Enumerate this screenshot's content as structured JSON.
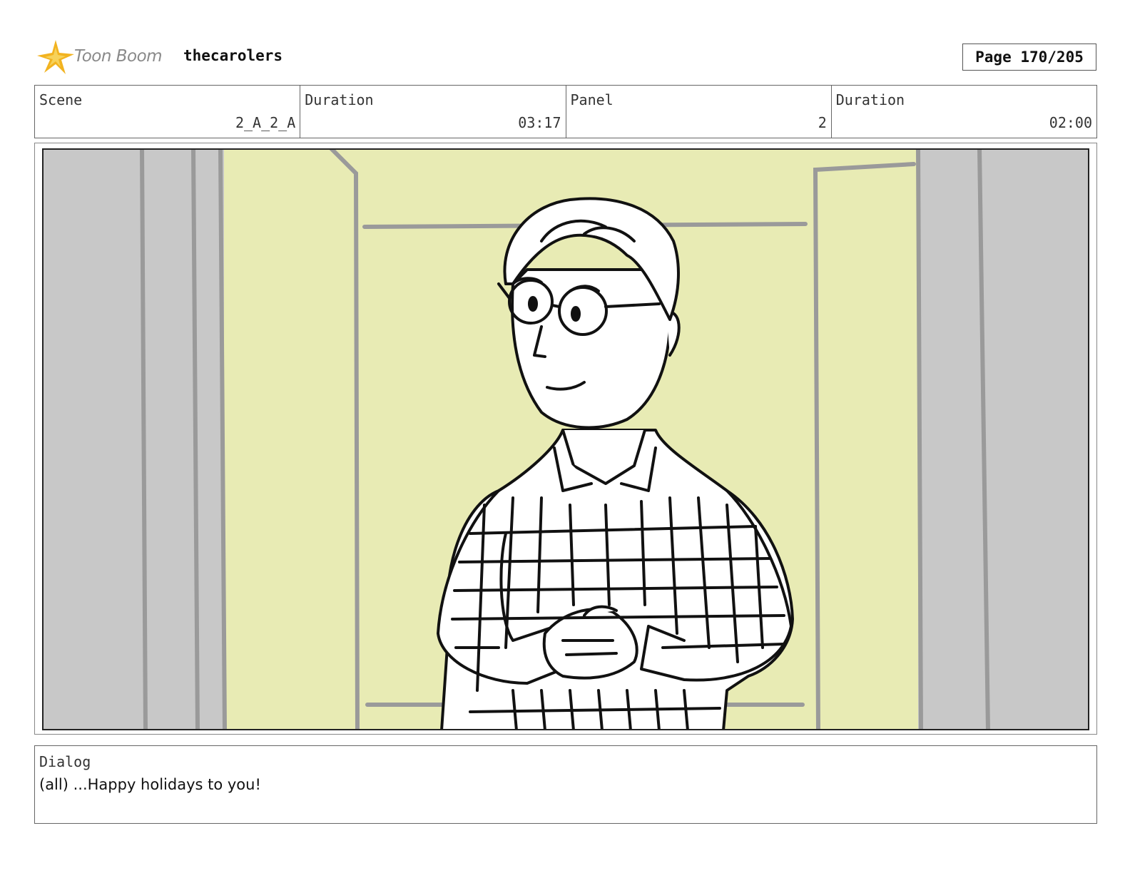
{
  "header": {
    "brand": "Toon Boom",
    "project": "thecarolers",
    "page": "Page 170/205"
  },
  "info": {
    "scene_label": "Scene",
    "scene_value": "2_A_2_A",
    "scene_duration_label": "Duration",
    "scene_duration_value": "03:17",
    "panel_label": "Panel",
    "panel_value": "2",
    "panel_duration_label": "Duration",
    "panel_duration_value": "02:00"
  },
  "dialog": {
    "label": "Dialog",
    "text": "(all) ...Happy holidays to you!"
  },
  "colors": {
    "background_wall": "#e8ebb4",
    "side_panels": "#c8c8c8",
    "door_lines": "#9a9a9a",
    "ink": "#111111",
    "logo_star": "#f2b320"
  }
}
